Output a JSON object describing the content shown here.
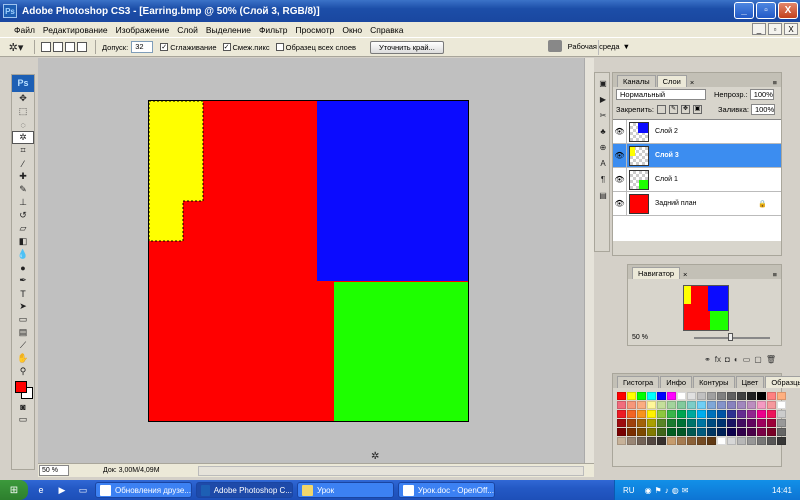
{
  "title_bar": {
    "app_label": "Ps",
    "title": "Adobe Photoshop CS3 - [Earring.bmp @ 50% (Слой 3, RGB/8)]",
    "buttons": [
      "_",
      "▫",
      "X"
    ]
  },
  "menu": {
    "items": [
      "Файл",
      "Редактирование",
      "Изображение",
      "Слой",
      "Выделение",
      "Фильтр",
      "Просмотр",
      "Окно",
      "Справка"
    ],
    "window_buttons": [
      "_",
      "▫",
      "X"
    ]
  },
  "options_bar": {
    "tolerance_label": "Допуск:",
    "tolerance_value": "32",
    "antialias_label": "Сглаживание",
    "antialias_checked": true,
    "contiguous_label": "Смеж.пикс",
    "contiguous_checked": true,
    "sample_all_label": "Образец всех слоев",
    "sample_all_checked": false,
    "refine_edge_label": "Уточнить край...",
    "workspace_label": "Рабочая среда"
  },
  "toolbox": {
    "logo": "Ps",
    "tools": [
      "move",
      "marquee",
      "lasso",
      "magic-wand",
      "crop",
      "slice",
      "healing",
      "brush",
      "stamp",
      "history-brush",
      "eraser",
      "paint-bucket",
      "blur",
      "dodge",
      "pen",
      "type",
      "path-select",
      "shape",
      "notes",
      "eyedropper",
      "hand",
      "zoom"
    ],
    "foreground_color": "#ff0000",
    "background_color": "#ffffff"
  },
  "document": {
    "colors": {
      "red": "#ff0000",
      "blue": "#0b0bff",
      "green": "#1eff00",
      "yellow": "#ffff00"
    }
  },
  "status_bar": {
    "zoom": "50 %",
    "doc_size": "Док: 3,00М/4,09М"
  },
  "layers_panel": {
    "tabs": [
      "Каналы",
      "Слои"
    ],
    "active_tab": "Слои",
    "blend_mode": "Нормальный",
    "opacity_label": "Непрозр.:",
    "opacity_value": "100%",
    "lock_label": "Закрепить:",
    "fill_label": "Заливка:",
    "fill_value": "100%",
    "layers": [
      {
        "name": "Слой 2",
        "selected": false,
        "thumb_color": "#0b0bff"
      },
      {
        "name": "Слой 3",
        "selected": true,
        "thumb_color": "#ffff00"
      },
      {
        "name": "Слой 1",
        "selected": false,
        "thumb_color": "#1eff00"
      },
      {
        "name": "Задний план",
        "selected": false,
        "thumb_color": "#ff0000"
      }
    ]
  },
  "navigator": {
    "tab": "Навигатор",
    "zoom": "50 %"
  },
  "swatches_panel": {
    "tabs": [
      "Гистогра",
      "Инфо",
      "Контуры",
      "Цвет",
      "Образцы"
    ],
    "active_tab": "Образцы"
  },
  "taskbar": {
    "tasks": [
      {
        "label": "Обновления друзе...",
        "active": false
      },
      {
        "label": "Adobe Photoshop C...",
        "active": true
      },
      {
        "label": "Урок",
        "active": false
      },
      {
        "label": "Урок.doc - OpenOff...",
        "active": false
      }
    ],
    "language": "RU",
    "clock": "14:41"
  }
}
